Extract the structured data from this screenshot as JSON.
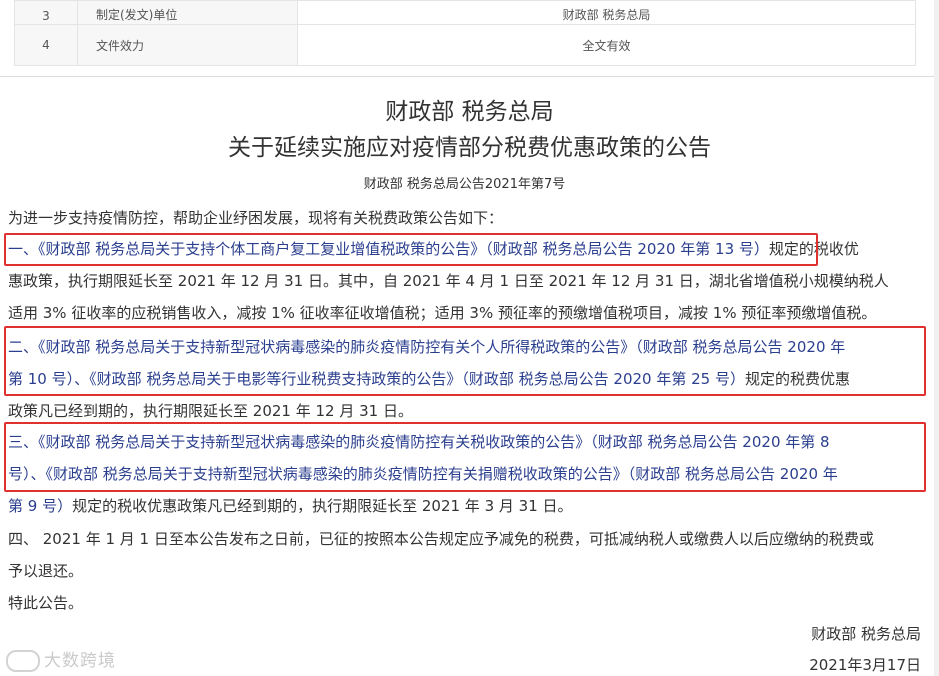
{
  "meta_table": {
    "rows": [
      {
        "num": "3",
        "key": "制定(发文)单位",
        "value": "财政部 税务总局"
      },
      {
        "num": "4",
        "key": "文件效力",
        "value": "全文有效"
      }
    ]
  },
  "document": {
    "title_line1": "财政部 税务总局",
    "title_line2": "关于延续实施应对疫情部分税费优惠政策的公告",
    "doc_number": "财政部 税务总局公告2021年第7号",
    "intro": "为进一步支持疫情防控，帮助企业纾困发展，现将有关税费政策公告如下：",
    "item1": {
      "prefix": "一、",
      "link": "《财政部 税务总局关于支持个体工商户复工复业增值税政策的公告》（财政部 税务总局公告 2020 年第 13 号）",
      "rest_line1": "规定的税收优",
      "line2": "惠政策，执行期限延长至 2021 年 12 月 31 日。其中，自 2021 年 4 月 1 日至 2021 年 12 月 31 日，湖北省增值税小规模纳税人",
      "line3": "适用 3% 征收率的应税销售收入，减按 1% 征收率征收增值税；适用 3% 预征率的预缴增值税项目，减按 1% 预征率预缴增值税。"
    },
    "item2": {
      "line1": "二、《财政部 税务总局关于支持新型冠状病毒感染的肺炎疫情防控有关个人所得税政策的公告》（财政部 税务总局公告 2020 年",
      "line2_link": "第 10 号）、《财政部 税务总局关于电影等行业税费支持政策的公告》（财政部 税务总局公告 2020 年第 25 号）",
      "line2_rest": "规定的税费优惠",
      "line3": "政策凡已经到期的，执行期限延长至 2021 年 12 月 31 日。"
    },
    "item3": {
      "line1": "三、《财政部 税务总局关于支持新型冠状病毒感染的肺炎疫情防控有关税收政策的公告》（财政部 税务总局公告 2020 年第 8",
      "line2": "号）、《财政部 税务总局关于支持新型冠状病毒感染的肺炎疫情防控有关捐赠税收政策的公告》（财政部 税务总局公告 2020 年",
      "line3_link": "第 9 号）",
      "line3_rest": "规定的税收优惠政策凡已经到期的，执行期限延长至 2021 年 3 月 31 日。"
    },
    "item4": {
      "line1": "四、 2021 年 1 月 1 日至本公告发布之日前，已征的按照本公告规定应予减免的税费，可抵减纳税人或缴费人以后应缴纳的税费或",
      "line2": "予以退还。"
    },
    "closing": "特此公告。",
    "signature": "财政部 税务总局",
    "date": "2021年3月17日"
  },
  "watermark": "大数跨境",
  "colors": {
    "link": "#2b3f8f",
    "highlight_box": "#e03131"
  }
}
